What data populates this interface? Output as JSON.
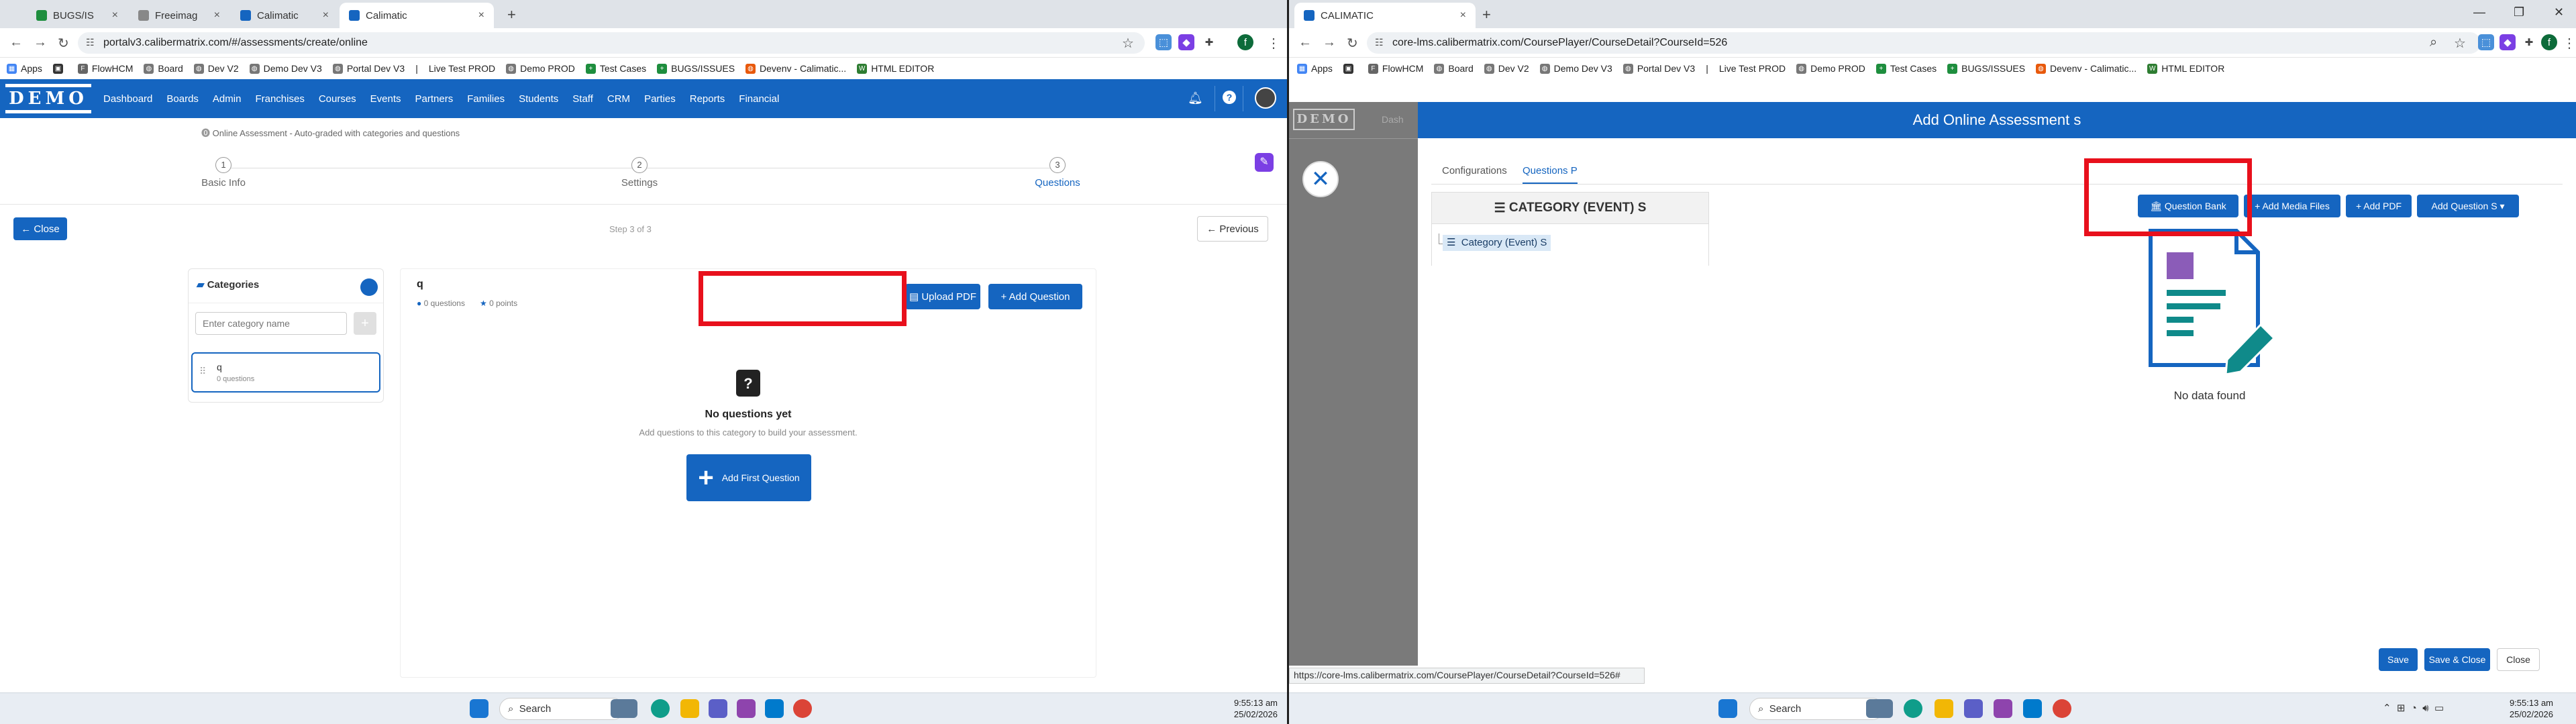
{
  "left": {
    "tabs": [
      {
        "label": "BUGS/IS",
        "color": "#1e8e3e"
      },
      {
        "label": "Freeimag",
        "color": "#888888"
      },
      {
        "label": "Calimatic",
        "color": "#1565c0"
      },
      {
        "label": "Calimatic",
        "color": "#1565c0"
      }
    ],
    "url": "portalv3.calibermatrix.com/#/assessments/create/online",
    "bookmarks": [
      "Apps",
      "FlowHCM",
      "Board",
      "Dev V2",
      "Demo Dev V3",
      "Portal Dev V3",
      "|",
      "Live Test PROD",
      "Demo PROD",
      "Test Cases",
      "BUGS/ISSUES",
      "Devenv - Calimatic...",
      "HTML EDITOR"
    ],
    "logo": "DEMO",
    "menu": [
      "Dashboard",
      "Boards",
      "Admin",
      "Franchises",
      "Courses",
      "Events",
      "Partners",
      "Families",
      "Students",
      "Staff",
      "CRM",
      "Parties",
      "Reports",
      "Financial"
    ],
    "subtitle": "Online Assessment - Auto-graded with categories and questions",
    "steps": [
      {
        "num": "1",
        "label": "Basic Info"
      },
      {
        "num": "2",
        "label": "Settings"
      },
      {
        "num": "3",
        "label": "Questions"
      }
    ],
    "close_label": "← Close",
    "step_of": "Step 3 of 3",
    "previous_label": "← Previous",
    "categories": {
      "title": "Categories",
      "placeholder": "Enter category name",
      "item_name": "q",
      "item_sub": "0 questions"
    },
    "question_panel": {
      "title": "q",
      "questions_count": "0 questions",
      "points_count": "0 points",
      "upload_pdf": "Upload PDF",
      "add_question": "+ Add Question",
      "empty_title": "No questions yet",
      "empty_sub": "Add questions to this category to build your assessment.",
      "add_first": "Add First Question"
    },
    "taskbar": {
      "search": "Search",
      "time": "9:55:13 am",
      "date": "25/02/2026"
    }
  },
  "right": {
    "tab_label": "CALIMATIC",
    "url": "core-lms.calibermatrix.com/CoursePlayer/CourseDetail?CourseId=526",
    "bookmarks": [
      "Apps",
      "FlowHCM",
      "Board",
      "Dev V2",
      "Demo Dev V3",
      "Portal Dev V3",
      "|",
      "Live Test PROD",
      "Demo PROD",
      "Test Cases",
      "BUGS/ISSUES",
      "Devenv - Calimatic...",
      "HTML EDITOR"
    ],
    "bg_logo": "DEMO",
    "bg_dash": "Dash",
    "modal_title": "Add Online Assessment s",
    "tabs": [
      "Configurations",
      "Questions P"
    ],
    "category_header": "CATEGORY (EVENT) S",
    "tree_item": "Category (Event) S",
    "buttons": {
      "question_bank": "Question Bank",
      "add_media": "+ Add Media Files",
      "add_pdf": "+ Add PDF",
      "add_question": "Add Question S ▾"
    },
    "empty_text": "No data found",
    "footer": {
      "save": "Save",
      "save_close": "Save & Close",
      "close": "Close"
    },
    "status_url": "https://core-lms.calibermatrix.com/CoursePlayer/CourseDetail?CourseId=526#",
    "taskbar": {
      "search": "Search",
      "time": "9:55:13 am",
      "date": "25/02/2026"
    }
  },
  "colors": {
    "primary": "#1565c0",
    "highlight": "#e8101c"
  }
}
